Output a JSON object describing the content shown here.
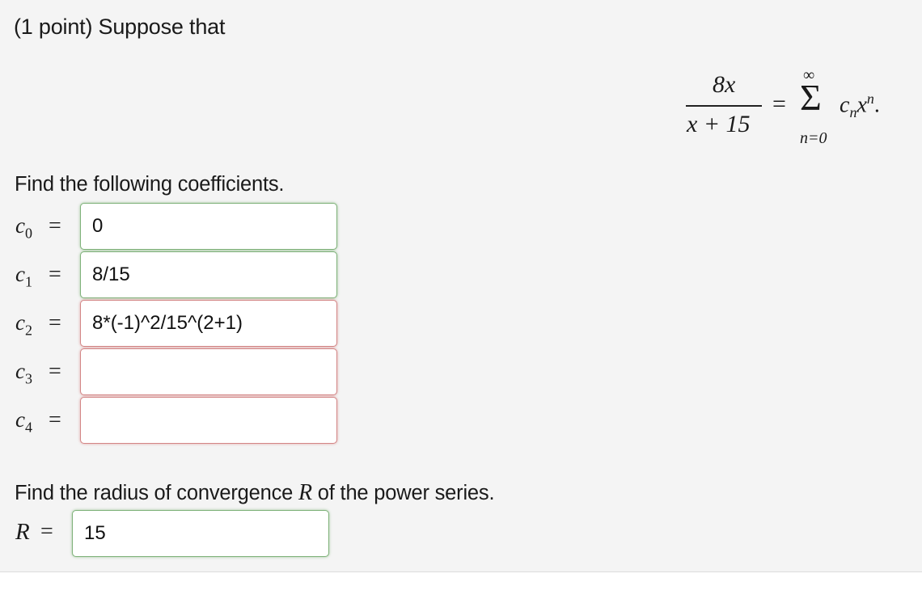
{
  "intro": "(1 point) Suppose that",
  "equation": {
    "numerator": "8x",
    "denominator": "x + 15",
    "equals": "=",
    "sum_upper": "∞",
    "sum_symbol": "Σ",
    "sum_lower": "n=0",
    "term_base": "c",
    "term_sub": "n",
    "term_var": "x",
    "term_sup": "n",
    "term_end": "."
  },
  "coefficients": {
    "prompt": "Find the following coefficients.",
    "equals": "=",
    "rows": [
      {
        "label": "c",
        "sub": "0",
        "value": "0",
        "status": "correct"
      },
      {
        "label": "c",
        "sub": "1",
        "value": "8/15",
        "status": "correct"
      },
      {
        "label": "c",
        "sub": "2",
        "value": "8*(-1)^2/15^(2+1)",
        "status": "incorrect"
      },
      {
        "label": "c",
        "sub": "3",
        "value": "",
        "status": "incorrect"
      },
      {
        "label": "c",
        "sub": "4",
        "value": "",
        "status": "incorrect"
      }
    ]
  },
  "radius": {
    "prompt_before": "Find the radius of convergence ",
    "prompt_symbol": "R",
    "prompt_after": " of the power series.",
    "label": "R",
    "equals": "=",
    "value": "15",
    "status": "correct"
  },
  "colors": {
    "panel_bg": "#f4f4f4",
    "correct_border": "#7fb27a",
    "incorrect_border": "#d38686"
  }
}
